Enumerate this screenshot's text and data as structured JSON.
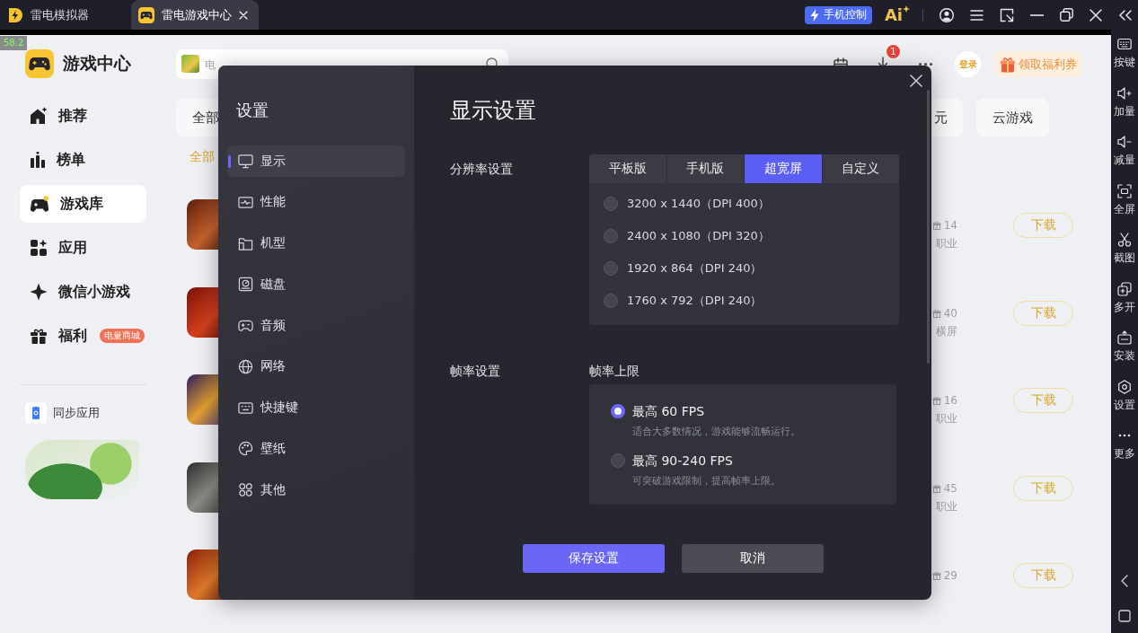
{
  "title_bar": {
    "tabs": [
      {
        "label": "雷电模拟器",
        "selected": false
      },
      {
        "label": "雷电游戏中心",
        "selected": true
      }
    ],
    "phone_control": "手机控制",
    "ai": "Ai"
  },
  "fps_counter": "58.2",
  "game_center": {
    "title": "游戏中心",
    "search": {
      "placeholder": "电"
    },
    "download_count": "1",
    "login": "登录",
    "coupon": "领取福利券",
    "nav": [
      {
        "label": "推荐",
        "selected": false
      },
      {
        "label": "榜单",
        "selected": false
      },
      {
        "label": "游戏库",
        "selected": true
      },
      {
        "label": "应用",
        "selected": false
      },
      {
        "label": "微信小游戏",
        "selected": false
      },
      {
        "label": "福利",
        "selected": false,
        "badge": "电量商城"
      }
    ],
    "sync_app": "同步应用",
    "categories": [
      "全部",
      "元",
      "云游戏"
    ],
    "filters": [
      {
        "label": "全部",
        "selected": true
      }
    ],
    "games": [
      {
        "gifts": "14",
        "tag": "职业",
        "action": "下载"
      },
      {
        "gifts": "40",
        "tag": "横屏",
        "action": "下载"
      },
      {
        "gifts": "16",
        "tag": "职业",
        "action": "下载"
      },
      {
        "gifts": "45",
        "tag": "职业",
        "action": "下载"
      },
      {
        "gifts": "29",
        "action": "下载"
      }
    ]
  },
  "toolbar": [
    "按键",
    "加量",
    "减量",
    "全屏",
    "截图",
    "多开",
    "安装",
    "设置",
    "更多"
  ],
  "dialog": {
    "title": "设置",
    "nav": [
      {
        "label": "显示",
        "selected": true
      },
      {
        "label": "性能",
        "selected": false
      },
      {
        "label": "机型",
        "selected": false
      },
      {
        "label": "磁盘",
        "selected": false
      },
      {
        "label": "音频",
        "selected": false
      },
      {
        "label": "网络",
        "selected": false
      },
      {
        "label": "快捷键",
        "selected": false
      },
      {
        "label": "壁纸",
        "selected": false
      },
      {
        "label": "其他",
        "selected": false
      }
    ],
    "heading": "显示设置",
    "resolution": {
      "label": "分辨率设置",
      "tabs": [
        {
          "label": "平板版",
          "selected": false
        },
        {
          "label": "手机版",
          "selected": false
        },
        {
          "label": "超宽屏",
          "selected": true
        },
        {
          "label": "自定义",
          "selected": false
        }
      ],
      "options": [
        {
          "label": "3200 x 1440（DPI 400）",
          "selected": false
        },
        {
          "label": "2400 x 1080（DPI 320）",
          "selected": false
        },
        {
          "label": "1920 x 864（DPI 240）",
          "selected": false
        },
        {
          "label": "1760 x 792（DPI 240）",
          "selected": false
        }
      ]
    },
    "frame_rate": {
      "label": "帧率设置",
      "sublabel": "帧率上限",
      "options": [
        {
          "label": "最高 60 FPS",
          "description": "适合大多数情况，游戏能够流畅运行。",
          "selected": true
        },
        {
          "label": "最高 90-240 FPS",
          "description": "可突破游戏限制，提高帧率上限。",
          "selected": false
        }
      ]
    },
    "buttons": [
      {
        "label": "保存设置",
        "kind": "primary"
      },
      {
        "label": "取消",
        "kind": "secondary"
      }
    ]
  }
}
